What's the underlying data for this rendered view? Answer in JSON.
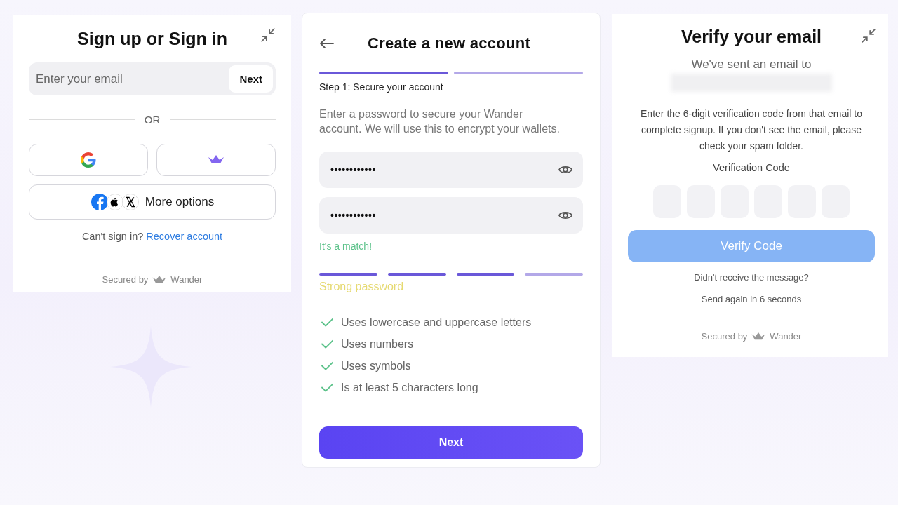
{
  "signin": {
    "title": "Sign up or Sign in",
    "email": {
      "placeholder": "Enter your email"
    },
    "next_button": "Next",
    "divider": "OR",
    "providers": [
      {
        "kind": "google"
      },
      {
        "kind": "wander"
      }
    ],
    "more_options": "More options",
    "recover_prompt": "Can't sign in?",
    "recover_link": "Recover account",
    "secured_by": "Secured by",
    "brand": "Wander"
  },
  "create": {
    "title": "Create a new account",
    "steps": [
      {
        "done": true
      },
      {
        "done": false
      }
    ],
    "step_label": "Step 1: Secure your account",
    "description": "Enter a password to secure your Wander account. We will use this to encrypt your wallets.",
    "passwords": [
      {
        "value": "••••••••••••"
      },
      {
        "value": "••••••••••••"
      }
    ],
    "match_message": "It's a match!",
    "strength": [
      {
        "filled": true
      },
      {
        "filled": true
      },
      {
        "filled": true
      },
      {
        "filled": false
      }
    ],
    "strength_label": "Strong password",
    "requirements": [
      {
        "label": "Uses lowercase and uppercase letters",
        "met": true
      },
      {
        "label": "Uses numbers",
        "met": true
      },
      {
        "label": "Uses symbols",
        "met": true
      },
      {
        "label": "Is at least 5 characters long",
        "met": true
      }
    ],
    "next_button": "Next"
  },
  "verify": {
    "title": "Verify your email",
    "subtitle": "We've sent an email to",
    "instructions": "Enter the 6-digit verification code from that email to complete signup. If you don't see the email, please check your spam folder.",
    "code_label": "Verification Code",
    "code_boxes": [
      {
        "filled": false
      },
      {
        "filled": false
      },
      {
        "filled": false
      },
      {
        "filled": false
      },
      {
        "filled": false
      },
      {
        "filled": false
      }
    ],
    "verify_button": {
      "label": "Verify Code",
      "disabled": true
    },
    "resend_prompt": "Didn't receive the message?",
    "resend_timer": "Send again in 6 seconds",
    "secured_by": "Secured by",
    "brand": "Wander"
  }
}
